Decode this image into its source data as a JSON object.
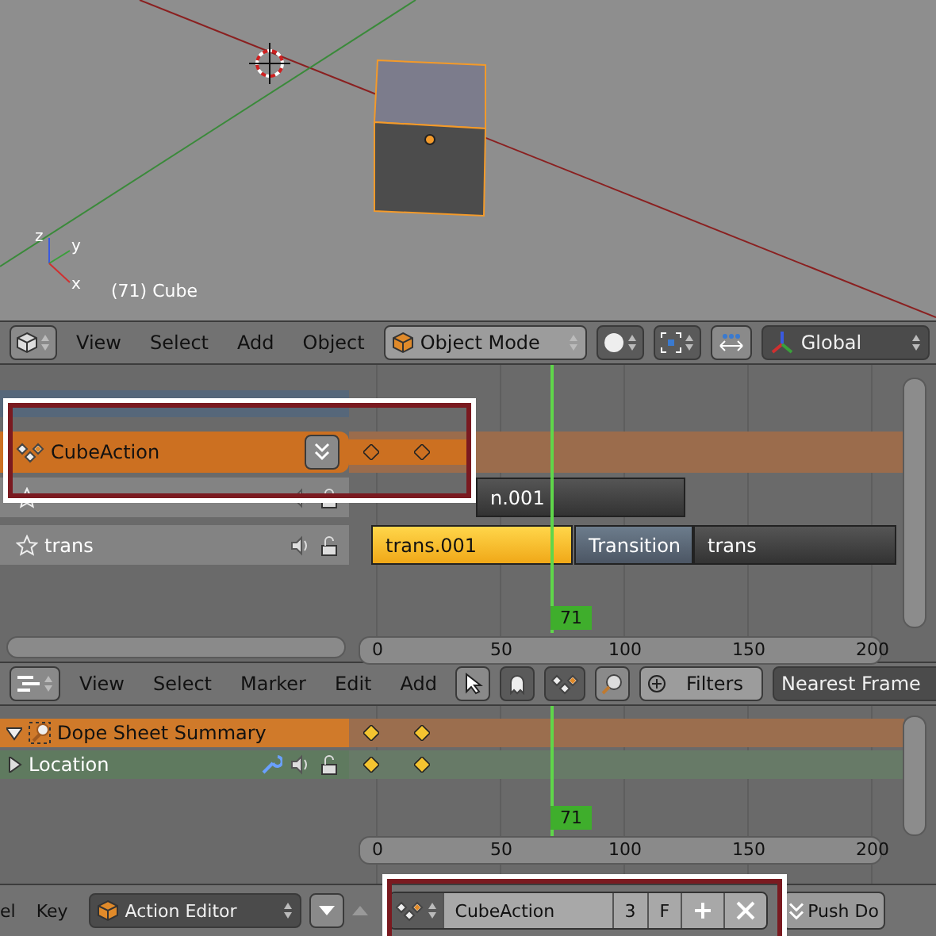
{
  "viewport": {
    "caption": "(71) Cube",
    "axis_labels": [
      "z",
      "y",
      "x"
    ]
  },
  "view3d_header": {
    "menus": [
      "View",
      "Select",
      "Add",
      "Object"
    ],
    "mode": "Object Mode",
    "orientation": "Global"
  },
  "nla": {
    "channels": [
      {
        "kind": "object",
        "selected": false
      },
      {
        "kind": "action",
        "name": "CubeAction",
        "selected": true
      },
      {
        "kind": "track",
        "selected": false,
        "strips": [
          {
            "label": "n.001",
            "kind": "action",
            "selected": false
          }
        ]
      },
      {
        "kind": "track",
        "name": "trans",
        "selected": false,
        "strips": [
          {
            "label": "trans.001",
            "kind": "action",
            "selected": true
          },
          {
            "label": "Transition",
            "kind": "transition",
            "selected": false
          },
          {
            "label": "trans",
            "kind": "action",
            "selected": false
          }
        ]
      }
    ],
    "current_frame": "71",
    "ruler": [
      "0",
      "50",
      "100",
      "150",
      "200"
    ]
  },
  "dope_header": {
    "menus": [
      "View",
      "Select",
      "Marker",
      "Edit",
      "Add"
    ],
    "filters": "Filters",
    "snap": "Nearest Frame"
  },
  "dope": {
    "channels": [
      {
        "kind": "summary",
        "name": "Dope Sheet Summary",
        "expanded": true
      },
      {
        "kind": "group",
        "name": "Location",
        "expanded": false
      }
    ],
    "current_frame": "71",
    "ruler": [
      "0",
      "50",
      "100",
      "150",
      "200"
    ]
  },
  "bottom_header": {
    "menus": [
      "el",
      "Key"
    ],
    "editor": "Action Editor",
    "action": "CubeAction",
    "users": "3",
    "fake_user": "F",
    "push_down": "Push Do"
  }
}
